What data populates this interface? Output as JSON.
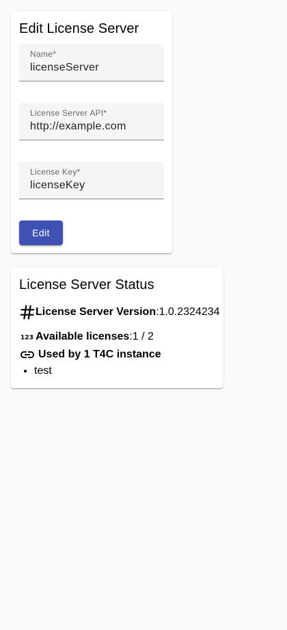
{
  "edit_form": {
    "title": "Edit License Server",
    "name_label": "Name*",
    "name_value": "licenseServer",
    "api_label": "License Server API*",
    "api_value": "http://example.com",
    "key_label": "License Key*",
    "key_value": "licenseKey",
    "edit_button_label": "Edit"
  },
  "status": {
    "title": "License Server Status",
    "version_label": "License Server Version",
    "version_separator": ": ",
    "version_value": "1.0.2324234",
    "licenses_label": "Available licenses",
    "licenses_separator": ": ",
    "licenses_value": "1 / 2",
    "used_by_label": "Used by 1 T4C instance",
    "instances": [
      "test"
    ],
    "icons": {
      "version": "tag-icon",
      "licenses": "numbers-icon",
      "used_by": "link-icon"
    }
  },
  "colors": {
    "primary": "#3f51b5",
    "background": "#fafafa",
    "field_background": "#f5f5f5"
  }
}
